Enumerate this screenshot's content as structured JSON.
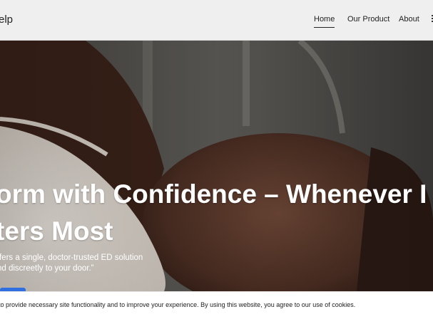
{
  "header": {
    "brand": "elp",
    "nav": [
      {
        "label": "Home",
        "active": true
      },
      {
        "label": "Our Product",
        "active": false
      },
      {
        "label": "About",
        "active": false
      }
    ]
  },
  "hero": {
    "title_line1": "orm with Confidence – Whenever I",
    "title_line2": "ters Most",
    "text_line1": "ffers a single, doctor-trusted ED solution",
    "text_line2": "nd discreetly to your door.”"
  },
  "cookie": {
    "text": "to provide necessary site functionality and to improve your experience. By using this website, you agree to our use of cookies."
  },
  "colors": {
    "header_bg": "#efefef",
    "text": "#222222",
    "hero_text": "#ffffff",
    "accent": "#2f6fe0"
  }
}
